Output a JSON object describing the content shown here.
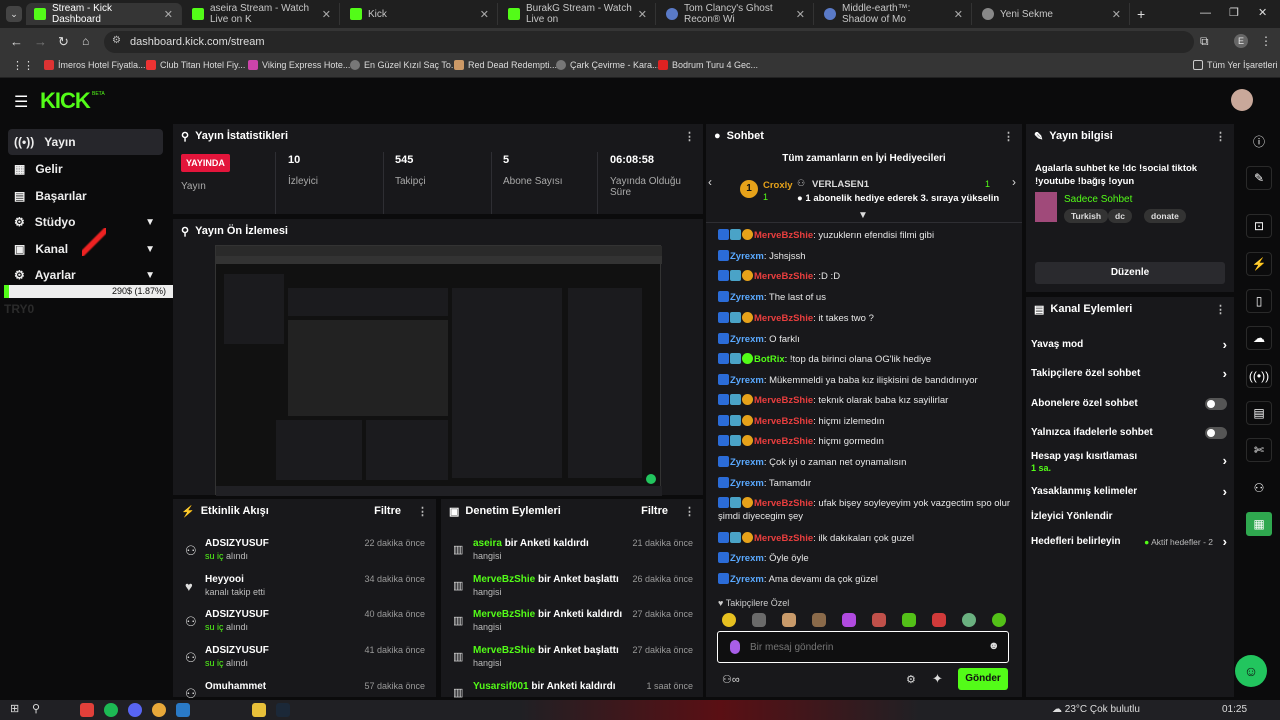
{
  "browser": {
    "tabs": [
      {
        "label": "Stream - Kick Dashboard",
        "fav": "#53fc18"
      },
      {
        "label": "aseira Stream - Watch Live on K",
        "fav": "#53fc18"
      },
      {
        "label": "Kick",
        "fav": "#53fc18"
      },
      {
        "label": "BurakG Stream - Watch Live on",
        "fav": "#53fc18"
      },
      {
        "label": "Tom Clancy's Ghost Recon® Wi",
        "fav": "#5a7ac7"
      },
      {
        "label": "Middle-earth™: Shadow of Mo",
        "fav": "#5a7ac7"
      },
      {
        "label": "Yeni Sekme",
        "fav": "#888"
      }
    ],
    "url": "dashboard.kick.com/stream",
    "bookmarks": [
      "İmeros Hotel Fiyatla...",
      "Club Titan Hotel Fiy...",
      "Viking Express Hote...",
      "En Güzel Kızıl Saç To...",
      "Red Dead Redempti...",
      "Çark Çevirme - Kara...",
      "Bodrum Turu 4 Gec..."
    ],
    "all_bookmarks": "Tüm Yer İşaretleri"
  },
  "logo": "KICK",
  "logo_sup": "BETA",
  "nav": {
    "items": [
      {
        "label": "Yayın",
        "icon": "((•))"
      },
      {
        "label": "Gelir",
        "icon": "▦"
      },
      {
        "label": "Başarılar",
        "icon": "▤"
      },
      {
        "label": "Stüdyo",
        "icon": "⚙"
      },
      {
        "label": "Kanal",
        "icon": "▣"
      },
      {
        "label": "Ayarlar",
        "icon": "⚙"
      }
    ],
    "progress_text": "290$ (1.87%)",
    "progress_fraction": 0.0187,
    "overlay_text": "TRY0"
  },
  "stats": {
    "title": "Yayın İstatistikleri",
    "live_badge": "YAYINDA",
    "live_label": "Yayın",
    "viewers": "10",
    "viewers_label": "İzleyici",
    "followers": "545",
    "followers_label": "Takipçi",
    "subs": "5",
    "subs_label": "Abone Sayısı",
    "uptime": "06:08:58",
    "uptime_label": "Yayında Olduğu Süre"
  },
  "preview": {
    "title": "Yayın Ön İzlemesi"
  },
  "activity": {
    "title": "Etkinlik Akışı",
    "filter": "Filtre",
    "rows": [
      {
        "name": "ADSIZYUSUF",
        "sub": "su iç",
        "sub2": "alındı",
        "time": "22 dakika önce",
        "icon": "⚇"
      },
      {
        "name": "Heyyooi",
        "sub": "",
        "sub2": "kanalı takip etti",
        "time": "34 dakika önce",
        "icon": "♥"
      },
      {
        "name": "ADSIZYUSUF",
        "sub": "su iç",
        "sub2": "alındı",
        "time": "40 dakika önce",
        "icon": "⚇"
      },
      {
        "name": "ADSIZYUSUF",
        "sub": "su iç",
        "sub2": "alındı",
        "time": "41 dakika önce",
        "icon": "⚇"
      },
      {
        "name": "Omuhammet",
        "sub": "",
        "sub2": "",
        "time": "57 dakika önce",
        "icon": "⚇"
      }
    ]
  },
  "moderation": {
    "title": "Denetim Eylemleri",
    "filter": "Filtre",
    "rows": [
      {
        "name": "aseira",
        "action": "bir Anketi kaldırdı",
        "sub": "hangisi",
        "time": "21 dakika önce"
      },
      {
        "name": "MerveBzShie",
        "action": "bir Anket başlattı",
        "sub": "hangisi",
        "time": "26 dakika önce"
      },
      {
        "name": "MerveBzShie",
        "action": "bir Anketi kaldırdı",
        "sub": "hangisi",
        "time": "27 dakika önce"
      },
      {
        "name": "MerveBzShie",
        "action": "bir Anket başlattı",
        "sub": "hangisi",
        "time": "27 dakika önce"
      },
      {
        "name": "Yusarsif001",
        "action": "bir Anketi kaldırdı",
        "sub": "",
        "time": "1 saat önce"
      }
    ]
  },
  "chat": {
    "title": "Sohbet",
    "gifters_title": "Tüm zamanların en İyi Hediyecileri",
    "gifter1": "Croxly",
    "gifter1_count": "1",
    "gifter2": "VERLASEN1",
    "gifter2_count": "1",
    "gifter_msg": "1 abonelik hediye ederek 3. sıraya yükselin",
    "messages": [
      {
        "user": "MerveBzShie",
        "color": "red",
        "text": "yuzuklerın efendisi filmi gibi"
      },
      {
        "user": "Zyrexm",
        "color": "blue",
        "text": "Jshsjssh"
      },
      {
        "user": "MerveBzShie",
        "color": "red",
        "text": ":D :D"
      },
      {
        "user": "Zyrexm",
        "color": "blue",
        "text": "The last of us"
      },
      {
        "user": "MerveBzShie",
        "color": "red",
        "text": "it takes two ?"
      },
      {
        "user": "Zyrexm",
        "color": "blue",
        "text": "O farklı"
      },
      {
        "user": "BotRix",
        "color": "green",
        "text": "!top da birinci olana OG'lik hediye"
      },
      {
        "user": "Zyrexm",
        "color": "blue",
        "text": "Mükemmeldi ya baba kız ilişkisini de bandıdınıyor"
      },
      {
        "user": "MerveBzShie",
        "color": "red",
        "text": "teknık olarak baba kız sayilirlar"
      },
      {
        "user": "MerveBzShie",
        "color": "red",
        "text": "hiçmı izlemedın"
      },
      {
        "user": "MerveBzShie",
        "color": "red",
        "text": "hiçmı gormedın"
      },
      {
        "user": "Zyrexm",
        "color": "blue",
        "text": "Çok iyi o zaman net oynamalısın"
      },
      {
        "user": "Zyrexm",
        "color": "blue",
        "text": "Tamamdır"
      },
      {
        "user": "MerveBzShie",
        "color": "red",
        "text": "ufak bişey soyleyeyim yok vazgectim spo olur şimdi diyecegim şey"
      },
      {
        "user": "MerveBzShie",
        "color": "red",
        "text": "ilk dakıkaları çok guzel"
      },
      {
        "user": "Zyrexm",
        "color": "blue",
        "text": "Öyle öyle"
      },
      {
        "user": "Zyrexm",
        "color": "blue",
        "text": "Ama devamı da çok güzel"
      }
    ],
    "followers_only": "Takipçilere Özel",
    "input_placeholder": "Bir mesaj gönderin",
    "send": "Gönder"
  },
  "info": {
    "title": "Yayın bilgisi",
    "stream_title": "Agalarla suhbet ke !dc !social tiktok !youtube !bağış !oyun",
    "category": "Sadece Sohbet",
    "tags": [
      "Turkish",
      "dc",
      "donate"
    ],
    "edit": "Düzenle"
  },
  "channel_actions": {
    "title": "Kanal Eylemleri",
    "slow": "Yavaş mod",
    "followers_chat": "Takipçilere özel sohbet",
    "subs_chat": "Abonelere özel sohbet",
    "emote_chat": "Yalnızca ifadelerle sohbet",
    "age_limit": "Hesap yaşı kısıtlaması",
    "age_value": "1 sa.",
    "banned_words": "Yasaklanmış kelimeler",
    "raid": "İzleyici Yönlendir",
    "goals": "Hedefleri belirleyin",
    "goals_status": "Aktif hedefler - 2"
  },
  "taskbar": {
    "weather": "23°C Çok bulutlu",
    "time": "01:25"
  }
}
